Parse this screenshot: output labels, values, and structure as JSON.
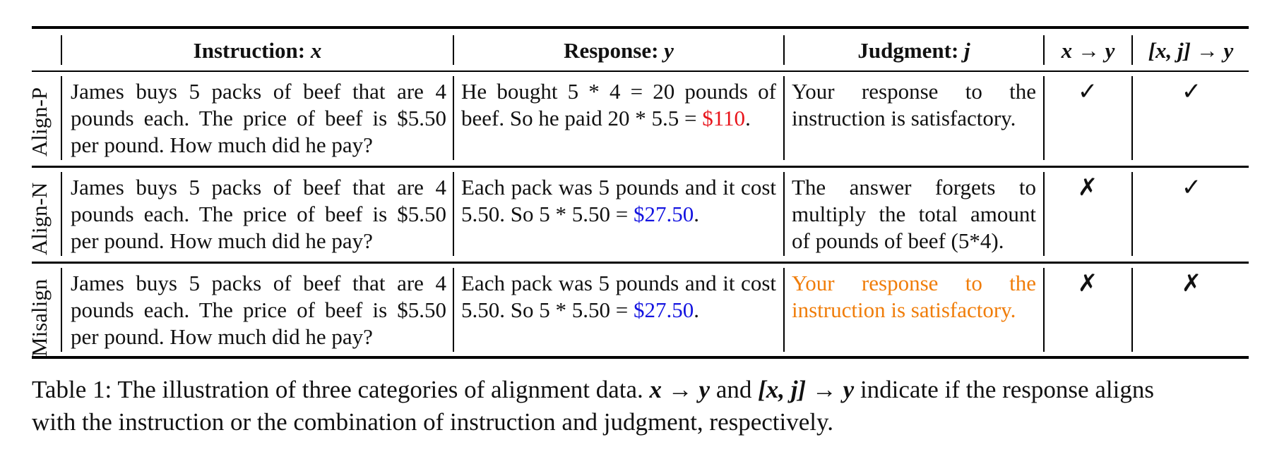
{
  "table": {
    "header": {
      "instruction_word": "Instruction",
      "instruction_var": "x",
      "response_word": "Response",
      "response_var": "y",
      "judgment_word": "Judgment",
      "judgment_var": "j",
      "col_xy": "x → y",
      "col_xjy": "[x, j] → y"
    },
    "rows": [
      {
        "label": "Align-P",
        "instruction": "James buys 5 packs of beef that are 4 pounds each. The price of beef is $5.50 per pound. How much did he pay?",
        "response_text": "He bought 5 * 4 = 20 pounds of beef. So he paid 20 * 5.5 = ",
        "response_answer": "$110",
        "response_end": ".",
        "response_answer_color": "#e8141b",
        "judgment": "Your response to the instruction is satisfactory.",
        "judgment_color": "#111111",
        "x_to_y": "✓",
        "xj_to_y": "✓"
      },
      {
        "label": "Align-N",
        "instruction": "James buys 5 packs of beef that are 4 pounds each. The price of beef is $5.50 per pound. How much did he pay?",
        "response_text": "Each pack was 5 pounds and it cost 5.50. So 5 * 5.50 = ",
        "response_answer": "$27.50",
        "response_end": ".",
        "response_answer_color": "#1414e0",
        "judgment": "The answer forgets to multiply the total amount of pounds of beef (5*4).",
        "judgment_color": "#111111",
        "x_to_y": "✗",
        "xj_to_y": "✓"
      },
      {
        "label": "Misalign",
        "instruction": "James buys 5 packs of beef that are 4 pounds each. The price of beef is $5.50 per pound. How much did he pay?",
        "response_text": "Each pack was 5 pounds and it cost 5.50. So 5 * 5.50 = ",
        "response_answer": "$27.50",
        "response_end": ".",
        "response_answer_color": "#1414e0",
        "judgment": "Your response to the instruction is satisfactory.",
        "judgment_color": "#f07d0a",
        "x_to_y": "✗",
        "xj_to_y": "✗"
      }
    ]
  },
  "caption": {
    "prefix": "Table 1: The illustration of three categories of alignment data. ",
    "math1": "x → y",
    "mid": " and ",
    "math2": "[x, j] → y",
    "suffix": " indicate if the response aligns",
    "line2": "with the instruction or the combination of instruction and judgment, respectively."
  }
}
